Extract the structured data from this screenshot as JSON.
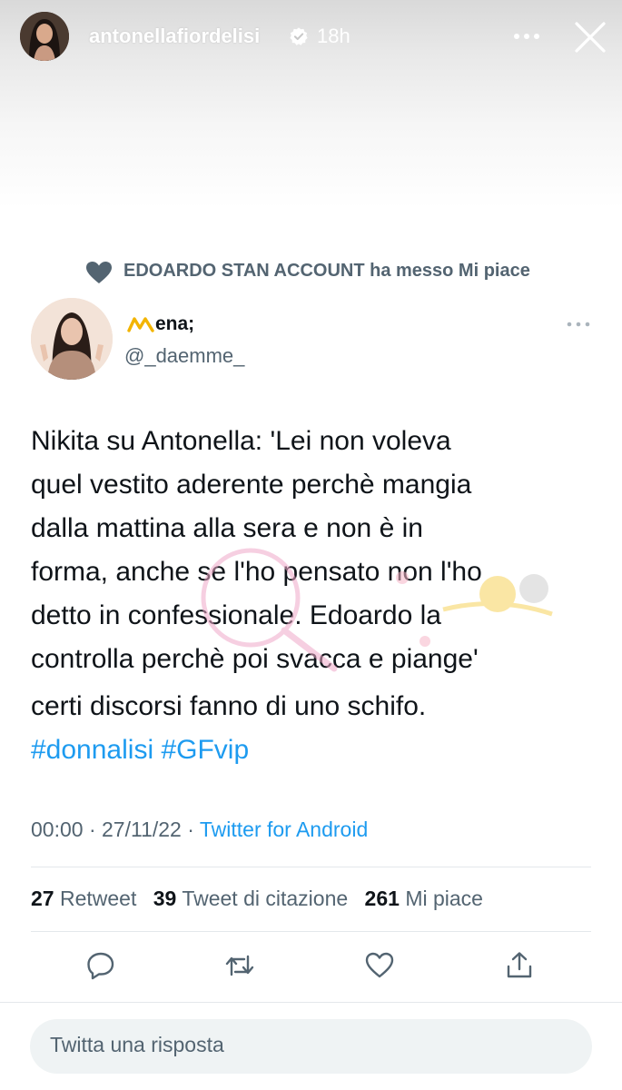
{
  "story": {
    "username": "antonellafiordelisi",
    "time_ago": "18h",
    "verified": true
  },
  "tweet": {
    "liked_by_text": "EDOARDO STAN ACCOUNT ha messo Mi piace",
    "author": {
      "display_name": "ena;",
      "handle": "@_daemme_"
    },
    "body_lines": [
      "Nikita su Antonella: 'Lei non voleva",
      "quel vestito aderente perchè mangia",
      "dalla mattina alla sera e non è in",
      "forma, anche se l'ho pensato non l'ho",
      "detto in confessionale. Edoardo la",
      "controlla perchè poi svacca e piange'",
      "certi discorsi fanno di uno schifo."
    ],
    "hashtags": [
      "#donnalisi",
      "#GFvip"
    ],
    "time": "00:00",
    "date": "27/11/22",
    "source": "Twitter for Android",
    "stats": {
      "retweets_count": "27",
      "retweets_label": "Retweet",
      "quotes_count": "39",
      "quotes_label": "Tweet di citazione",
      "likes_count": "261",
      "likes_label": "Mi piace"
    }
  },
  "reply": {
    "placeholder": "Twitta una risposta"
  },
  "colors": {
    "link_blue": "#1d9bf0",
    "secondary_text": "#536471",
    "primary_text": "#0f1419",
    "reply_background": "#eff3f4"
  },
  "icons": {
    "story_close": "close-icon",
    "story_more": "more-horizontal-icon",
    "liked": "heart-filled-icon",
    "actions": [
      "reply-icon",
      "retweet-icon",
      "like-icon",
      "share-icon"
    ]
  }
}
